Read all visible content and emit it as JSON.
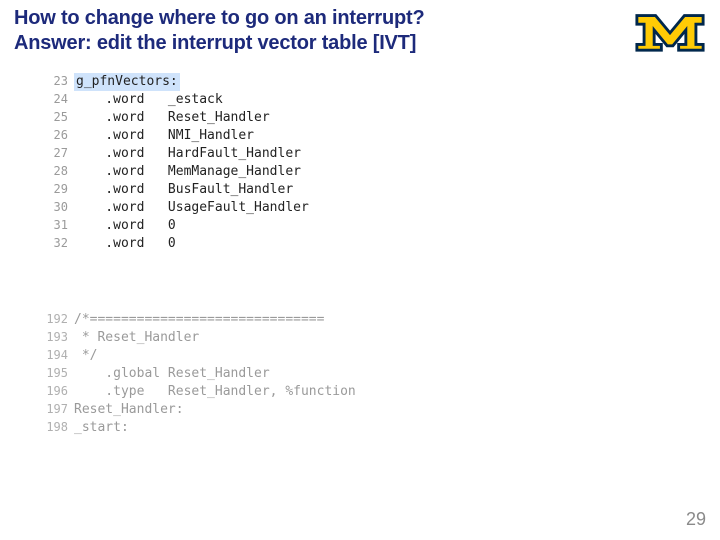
{
  "title": {
    "line1": "How to change where to go on an interrupt?",
    "line2": "Answer: edit the interrupt vector table [IVT]"
  },
  "logo_alt": "Block M logo",
  "code1": {
    "lines": [
      {
        "n": "23",
        "highlight": true,
        "text": "g_pfnVectors:"
      },
      {
        "n": "24",
        "highlight": false,
        "text": "    .word   _estack"
      },
      {
        "n": "25",
        "highlight": false,
        "text": "    .word   Reset_Handler"
      },
      {
        "n": "26",
        "highlight": false,
        "text": "    .word   NMI_Handler"
      },
      {
        "n": "27",
        "highlight": false,
        "text": "    .word   HardFault_Handler"
      },
      {
        "n": "28",
        "highlight": false,
        "text": "    .word   MemManage_Handler"
      },
      {
        "n": "29",
        "highlight": false,
        "text": "    .word   BusFault_Handler"
      },
      {
        "n": "30",
        "highlight": false,
        "text": "    .word   UsageFault_Handler"
      },
      {
        "n": "31",
        "highlight": false,
        "text": "    .word   0"
      },
      {
        "n": "32",
        "highlight": false,
        "text": "    .word   0"
      }
    ]
  },
  "code2": {
    "lines": [
      {
        "n": "192",
        "text": "/*=============================="
      },
      {
        "n": "193",
        "text": " * Reset_Handler"
      },
      {
        "n": "194",
        "text": " */"
      },
      {
        "n": "195",
        "text": "    .global Reset_Handler"
      },
      {
        "n": "196",
        "text": "    .type   Reset_Handler, %function"
      },
      {
        "n": "197",
        "text": "Reset_Handler:"
      },
      {
        "n": "198",
        "text": "_start:"
      }
    ]
  },
  "page_number": "29"
}
